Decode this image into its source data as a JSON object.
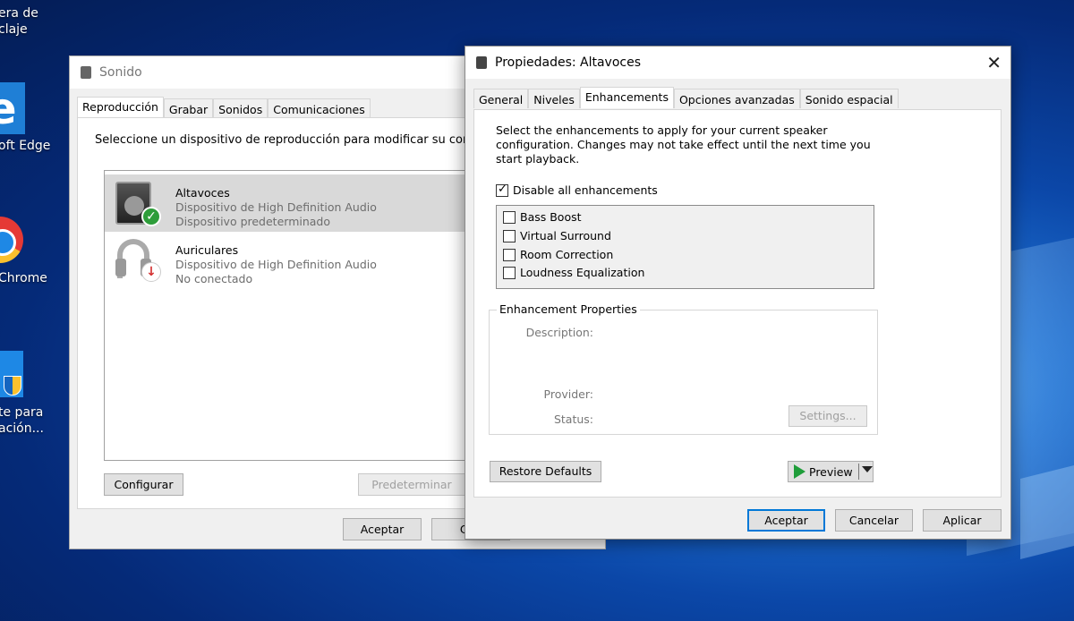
{
  "desktop": {
    "icons": [
      {
        "line1": "era de",
        "line2": "claje"
      },
      {
        "line1": "oft Edge"
      },
      {
        "line1": "Chrome"
      },
      {
        "line1": "te para",
        "line2": "ación..."
      }
    ]
  },
  "sonido": {
    "title": "Sonido",
    "tabs": [
      "Reproducción",
      "Grabar",
      "Sonidos",
      "Comunicaciones"
    ],
    "instruction": "Seleccione un dispositivo de reproducción para modificar su con",
    "devices": [
      {
        "name": "Altavoces",
        "driver": "Dispositivo de High Definition Audio",
        "status": "Dispositivo predeterminado"
      },
      {
        "name": "Auriculares",
        "driver": "Dispositivo de High Definition Audio",
        "status": "No conectado"
      }
    ],
    "configure_label": "Configurar",
    "default_label": "Predeterminar",
    "ok_label": "Aceptar",
    "cancel_label": "Can"
  },
  "props": {
    "title": "Propiedades: Altavoces",
    "close": "✕",
    "tabs": [
      "General",
      "Niveles",
      "Enhancements",
      "Opciones avanzadas",
      "Sonido espacial"
    ],
    "description": "Select the enhancements to apply for your current speaker configuration. Changes may not take effect until the next time you start playback.",
    "disable_all": {
      "label": "Disable all enhancements",
      "checked": true
    },
    "enhancements": [
      "Bass Boost",
      "Virtual Surround",
      "Room Correction",
      "Loudness Equalization"
    ],
    "group_title": "Enhancement Properties",
    "description_label": "Description:",
    "provider_label": "Provider:",
    "status_label": "Status:",
    "settings_label": "Settings...",
    "restore_label": "Restore Defaults",
    "preview_label": "Preview",
    "ok_label": "Aceptar",
    "cancel_label": "Cancelar",
    "apply_label": "Aplicar"
  }
}
